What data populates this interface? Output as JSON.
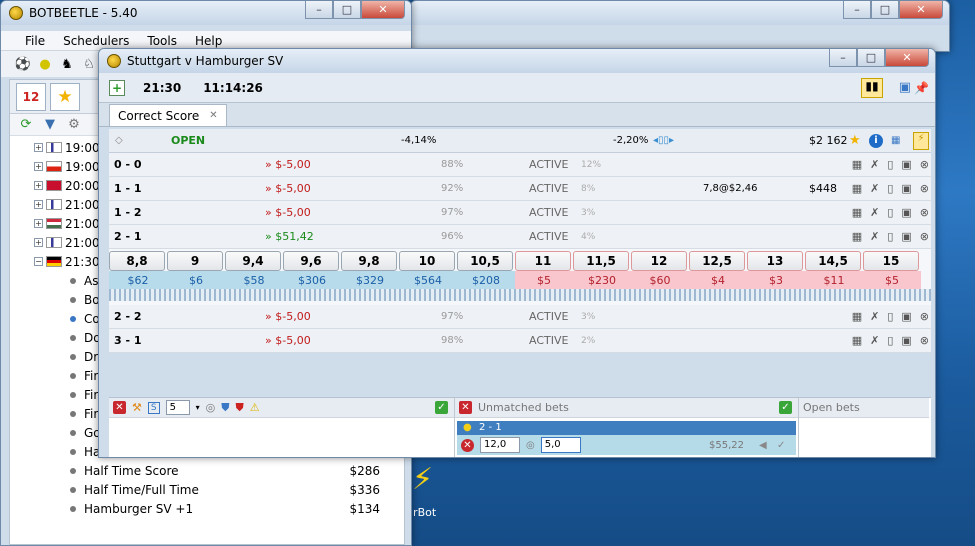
{
  "colors": {
    "back": "#b7dbea",
    "lay": "#f8c6cc",
    "loss": "#c01b1b",
    "profit": "#1a8a1a"
  },
  "main_window": {
    "title": "BOTBEETLE - 5.40",
    "menu": [
      "File",
      "Schedulers",
      "Tools",
      "Help"
    ],
    "tree_events": [
      {
        "time": "19:00"
      },
      {
        "time": "19:00"
      },
      {
        "time": "20:00"
      },
      {
        "time": "21:00"
      },
      {
        "time": "21:00"
      },
      {
        "time": "21:00"
      },
      {
        "time": "21:30"
      }
    ],
    "tree_markets": [
      {
        "name": "As"
      },
      {
        "name": "Bo"
      },
      {
        "name": "Co"
      },
      {
        "name": "Do"
      },
      {
        "name": "Dr"
      },
      {
        "name": "Fir"
      },
      {
        "name": "Fir"
      },
      {
        "name": "Fir"
      },
      {
        "name": "Go"
      },
      {
        "name": "Ha"
      },
      {
        "name": "Half Time Score",
        "value": "$286"
      },
      {
        "name": "Half Time/Full Time",
        "value": "$336"
      },
      {
        "name": "Hamburger SV +1",
        "value": "$134"
      }
    ],
    "desktop_icon_label": "irBot"
  },
  "match_window": {
    "title": "Stuttgart v Hamburger SV",
    "start_time": "21:30",
    "clock": "11:14:26",
    "tab_label": "Correct Score",
    "status": "OPEN",
    "pct_back": "-4,14%",
    "pct_lay": "-2,20%",
    "bank": "$2 162",
    "selections_top": [
      {
        "name": "0 - 0",
        "pl": "» $-5,00",
        "pl_class": "red",
        "pct": "88%",
        "state": "ACTIVE",
        "pct2": "12%",
        "extra": "",
        "amount": ""
      },
      {
        "name": "1 - 1",
        "pl": "» $-5,00",
        "pl_class": "red",
        "pct": "92%",
        "state": "ACTIVE",
        "pct2": "8%",
        "extra": "7,8@$2,46",
        "amount": "$448"
      },
      {
        "name": "1 - 2",
        "pl": "» $-5,00",
        "pl_class": "red",
        "pct": "97%",
        "state": "ACTIVE",
        "pct2": "3%",
        "extra": "",
        "amount": ""
      },
      {
        "name": "2 - 1",
        "pl": "» $51,42",
        "pl_class": "green",
        "pct": "96%",
        "state": "ACTIVE",
        "pct2": "4%",
        "extra": "",
        "amount": ""
      }
    ],
    "ladder_back": [
      {
        "odds": "8,8",
        "stake": "$62"
      },
      {
        "odds": "9",
        "stake": "$6"
      },
      {
        "odds": "9,4",
        "stake": "$58"
      },
      {
        "odds": "9,6",
        "stake": "$306"
      },
      {
        "odds": "9,8",
        "stake": "$329"
      },
      {
        "odds": "10",
        "stake": "$564"
      },
      {
        "odds": "10,5",
        "stake": "$208"
      }
    ],
    "ladder_lay": [
      {
        "odds": "11",
        "stake": "$5"
      },
      {
        "odds": "11,5",
        "stake": "$230"
      },
      {
        "odds": "12",
        "stake": "$60"
      },
      {
        "odds": "12,5",
        "stake": "$4"
      },
      {
        "odds": "13",
        "stake": "$3"
      },
      {
        "odds": "14,5",
        "stake": "$11"
      },
      {
        "odds": "15",
        "stake": "$5"
      }
    ],
    "selections_bottom": [
      {
        "name": "2 - 2",
        "pl": "» $-5,00",
        "pl_class": "red",
        "pct": "97%",
        "state": "ACTIVE",
        "pct2": "3%"
      },
      {
        "name": "3 - 1",
        "pl": "» $-5,00",
        "pl_class": "red",
        "pct": "98%",
        "state": "ACTIVE",
        "pct2": "2%"
      }
    ],
    "bet_pane": {
      "stake_spin": "5"
    },
    "unmatched": {
      "title": "Unmatched bets",
      "selection": "2 - 1",
      "odds_value": "12,0",
      "stake_value": "5,0",
      "liability": "$55,22"
    },
    "open_bets_title": "Open bets"
  }
}
